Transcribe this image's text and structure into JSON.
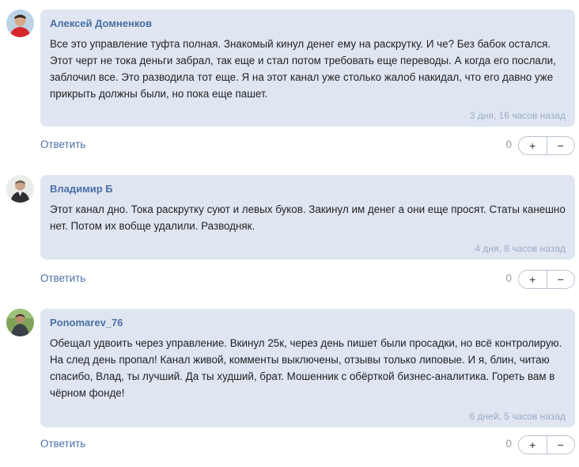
{
  "comments": [
    {
      "author": "Алексей Домненков",
      "avatar_icon": "user-avatar-red-shirt",
      "text": "Все это управление туфта полная. Знакомый кинул денег ему на раскрутку. И че? Без бабок остался. Этот черт не тока деньги забрал, так еще и стал потом требовать еще переводы. А когда его послали, заблочил все. Это разводила тот еще. Я на этот канал уже столько жалоб накидал, что его давно уже прикрыть должны были, но пока еще пашет.",
      "date": "3 дня, 16 часов назад",
      "reply_label": "Ответить",
      "score": "0",
      "upvote_label": "+",
      "downvote_label": "−"
    },
    {
      "author": "Владимир Б",
      "avatar_icon": "user-avatar-photo",
      "text": "Этот канал дно. Тока раскрутку суют и левых буков. Закинул им денег а они еще просят. Статы канешно нет. Потом их вобще удалили. Разводняк.",
      "date": "4 дня, 8 часов назад",
      "reply_label": "Ответить",
      "score": "0",
      "upvote_label": "+",
      "downvote_label": "−"
    },
    {
      "author": "Ponomarev_76",
      "avatar_icon": "user-avatar-outdoor",
      "text": "Обещал удвоить через управление. Вкинул 25к, через день пишет были просадки, но всё контролирую. На след день пропал! Канал живой, комменты выключены, отзывы только липовые. И я, блин, читаю спасибо, Влад, ты лучший. Да ты худший, брат. Мошенник с обёрткой бизнес-аналитика. Гореть вам в чёрном фонде!",
      "date": "6 дней, 5 часов назад",
      "reply_label": "Ответить",
      "score": "0",
      "upvote_label": "+",
      "downvote_label": "−"
    }
  ]
}
